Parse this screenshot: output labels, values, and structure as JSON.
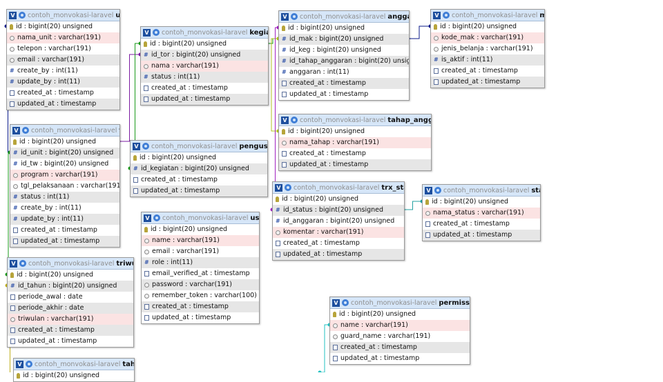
{
  "db_name": "contoh_monvokasi-laravel",
  "toggle_label": "V",
  "tables": [
    {
      "id": "unit",
      "name": "unit",
      "columns": [
        {
          "text": "id : bigint(20) unsigned",
          "icon": "key",
          "style": "pk"
        },
        {
          "text": "nama_unit : varchar(191)",
          "icon": "txt",
          "style": "hl"
        },
        {
          "text": "telepon : varchar(191)",
          "icon": "txt",
          "style": ""
        },
        {
          "text": "email : varchar(191)",
          "icon": "txt",
          "style": "zebra"
        },
        {
          "text": "create_by : int(11)",
          "icon": "hash",
          "style": ""
        },
        {
          "text": "update_by : int(11)",
          "icon": "hash",
          "style": "zebra"
        },
        {
          "text": "created_at : timestamp",
          "icon": "cal",
          "style": ""
        },
        {
          "text": "updated_at : timestamp",
          "icon": "cal",
          "style": "zebra"
        }
      ]
    },
    {
      "id": "kegiatan",
      "name": "kegiatan",
      "columns": [
        {
          "text": "id : bigint(20) unsigned",
          "icon": "key",
          "style": "pk"
        },
        {
          "text": "id_tor : bigint(20) unsigned",
          "icon": "hash",
          "style": "zebra"
        },
        {
          "text": "nama : varchar(191)",
          "icon": "txt",
          "style": "hl"
        },
        {
          "text": "status : int(11)",
          "icon": "hash",
          "style": "zebra"
        },
        {
          "text": "created_at : timestamp",
          "icon": "cal",
          "style": ""
        },
        {
          "text": "updated_at : timestamp",
          "icon": "cal",
          "style": "zebra"
        }
      ]
    },
    {
      "id": "anggaran",
      "name": "anggaran",
      "columns": [
        {
          "text": "id : bigint(20) unsigned",
          "icon": "key",
          "style": "pk"
        },
        {
          "text": "id_mak : bigint(20) unsigned",
          "icon": "hash",
          "style": "zebra"
        },
        {
          "text": "id_keg : bigint(20) unsigned",
          "icon": "hash",
          "style": ""
        },
        {
          "text": "id_tahap_anggaran : bigint(20) unsigned",
          "icon": "hash",
          "style": "zebra"
        },
        {
          "text": "anggaran : int(11)",
          "icon": "hash",
          "style": ""
        },
        {
          "text": "created_at : timestamp",
          "icon": "cal",
          "style": "zebra"
        },
        {
          "text": "updated_at : timestamp",
          "icon": "cal",
          "style": ""
        }
      ]
    },
    {
      "id": "mak",
      "name": "mak",
      "columns": [
        {
          "text": "id : bigint(20) unsigned",
          "icon": "key",
          "style": "pk"
        },
        {
          "text": "kode_mak : varchar(191)",
          "icon": "txt",
          "style": "hl"
        },
        {
          "text": "jenis_belanja : varchar(191)",
          "icon": "txt",
          "style": ""
        },
        {
          "text": "is_aktif : int(11)",
          "icon": "hash",
          "style": "zebra"
        },
        {
          "text": "created_at : timestamp",
          "icon": "cal",
          "style": ""
        },
        {
          "text": "updated_at : timestamp",
          "icon": "cal",
          "style": "zebra"
        }
      ]
    },
    {
      "id": "tor",
      "name": "tor",
      "columns": [
        {
          "text": "id : bigint(20) unsigned",
          "icon": "key",
          "style": "pk"
        },
        {
          "text": "id_unit : bigint(20) unsigned",
          "icon": "hash",
          "style": "zebra"
        },
        {
          "text": "id_tw : bigint(20) unsigned",
          "icon": "hash",
          "style": ""
        },
        {
          "text": "program : varchar(191)",
          "icon": "txt",
          "style": "hl"
        },
        {
          "text": "tgl_pelaksanaan : varchar(191)",
          "icon": "txt",
          "style": ""
        },
        {
          "text": "status : int(11)",
          "icon": "hash",
          "style": "zebra"
        },
        {
          "text": "create_by : int(11)",
          "icon": "hash",
          "style": ""
        },
        {
          "text": "update_by : int(11)",
          "icon": "hash",
          "style": "zebra"
        },
        {
          "text": "created_at : timestamp",
          "icon": "cal",
          "style": ""
        },
        {
          "text": "updated_at : timestamp",
          "icon": "cal",
          "style": "zebra"
        }
      ]
    },
    {
      "id": "pengusulan",
      "name": "pengusulan",
      "columns": [
        {
          "text": "id : bigint(20) unsigned",
          "icon": "key",
          "style": "pk"
        },
        {
          "text": "id_kegiatan : bigint(20) unsigned",
          "icon": "hash",
          "style": "zebra"
        },
        {
          "text": "created_at : timestamp",
          "icon": "cal",
          "style": ""
        },
        {
          "text": "updated_at : timestamp",
          "icon": "cal",
          "style": "zebra"
        }
      ]
    },
    {
      "id": "tahap_anggaran",
      "name": "tahap_anggaran",
      "columns": [
        {
          "text": "id : bigint(20) unsigned",
          "icon": "key",
          "style": "pk"
        },
        {
          "text": "nama_tahap : varchar(191)",
          "icon": "txt",
          "style": "hl"
        },
        {
          "text": "created_at : timestamp",
          "icon": "cal",
          "style": ""
        },
        {
          "text": "updated_at : timestamp",
          "icon": "cal",
          "style": "zebra"
        }
      ]
    },
    {
      "id": "trx_status",
      "name": "trx_status",
      "columns": [
        {
          "text": "id : bigint(20) unsigned",
          "icon": "key",
          "style": "pk"
        },
        {
          "text": "id_status : bigint(20) unsigned",
          "icon": "hash",
          "style": "zebra"
        },
        {
          "text": "id_anggaran : bigint(20) unsigned",
          "icon": "hash",
          "style": ""
        },
        {
          "text": "komentar : varchar(191)",
          "icon": "txt",
          "style": "hl"
        },
        {
          "text": "created_at : timestamp",
          "icon": "cal",
          "style": ""
        },
        {
          "text": "updated_at : timestamp",
          "icon": "cal",
          "style": "zebra"
        }
      ]
    },
    {
      "id": "status",
      "name": "status",
      "columns": [
        {
          "text": "id : bigint(20) unsigned",
          "icon": "key",
          "style": "pk"
        },
        {
          "text": "nama_status : varchar(191)",
          "icon": "txt",
          "style": "hl"
        },
        {
          "text": "created_at : timestamp",
          "icon": "cal",
          "style": ""
        },
        {
          "text": "updated_at : timestamp",
          "icon": "cal",
          "style": "zebra"
        }
      ]
    },
    {
      "id": "users",
      "name": "users",
      "columns": [
        {
          "text": "id : bigint(20) unsigned",
          "icon": "key",
          "style": "pk"
        },
        {
          "text": "name : varchar(191)",
          "icon": "txt",
          "style": "hl"
        },
        {
          "text": "email : varchar(191)",
          "icon": "txt",
          "style": ""
        },
        {
          "text": "role : int(11)",
          "icon": "hash",
          "style": "zebra"
        },
        {
          "text": "email_verified_at : timestamp",
          "icon": "cal",
          "style": ""
        },
        {
          "text": "password : varchar(191)",
          "icon": "txt",
          "style": "zebra"
        },
        {
          "text": "remember_token : varchar(100)",
          "icon": "txt",
          "style": ""
        },
        {
          "text": "created_at : timestamp",
          "icon": "cal",
          "style": "zebra"
        },
        {
          "text": "updated_at : timestamp",
          "icon": "cal",
          "style": ""
        }
      ]
    },
    {
      "id": "triwulan",
      "name": "triwulan",
      "columns": [
        {
          "text": "id : bigint(20) unsigned",
          "icon": "key",
          "style": "pk"
        },
        {
          "text": "id_tahun : bigint(20) unsigned",
          "icon": "hash",
          "style": "zebra"
        },
        {
          "text": "periode_awal : date",
          "icon": "cal",
          "style": ""
        },
        {
          "text": "periode_akhir : date",
          "icon": "cal",
          "style": "zebra"
        },
        {
          "text": "triwulan : varchar(191)",
          "icon": "txt",
          "style": "hl"
        },
        {
          "text": "created_at : timestamp",
          "icon": "cal",
          "style": "zebra"
        },
        {
          "text": "updated_at : timestamp",
          "icon": "cal",
          "style": ""
        }
      ]
    },
    {
      "id": "permissions",
      "name": "permissions",
      "columns": [
        {
          "text": "id : bigint(20) unsigned",
          "icon": "key",
          "style": "pk"
        },
        {
          "text": "name : varchar(191)",
          "icon": "txt",
          "style": "hl"
        },
        {
          "text": "guard_name : varchar(191)",
          "icon": "txt",
          "style": ""
        },
        {
          "text": "created_at : timestamp",
          "icon": "cal",
          "style": "zebra"
        },
        {
          "text": "updated_at : timestamp",
          "icon": "cal",
          "style": ""
        }
      ]
    },
    {
      "id": "tahun",
      "name": "tahun",
      "columns": [
        {
          "text": "id : bigint(20) unsigned",
          "icon": "key",
          "style": "pk"
        }
      ]
    }
  ],
  "relations": [
    {
      "from": "tor",
      "to": "unit",
      "color": "#0a1a8a"
    },
    {
      "from": "kegiatan",
      "to": "tor",
      "color": "#7a1aa0"
    },
    {
      "from": "pengusulan",
      "to": "kegiatan",
      "color": "#1a9a1a"
    },
    {
      "from": "anggaran",
      "to": "kegiatan",
      "color": "#1a9a1a"
    },
    {
      "from": "anggaran",
      "to": "mak",
      "color": "#0a1a8a"
    },
    {
      "from": "anggaran",
      "to": "tahap_anggaran",
      "color": "#b0c020"
    },
    {
      "from": "trx_status",
      "to": "anggaran",
      "color": "#a020c0"
    },
    {
      "from": "trx_status",
      "to": "status",
      "color": "#20a0a0"
    },
    {
      "from": "tor",
      "to": "triwulan",
      "color": "#1a9a1a"
    },
    {
      "from": "triwulan",
      "to": "tahun",
      "color": "#c0b020"
    },
    {
      "from": "permissions",
      "to": "offscreen",
      "color": "#20c0c0"
    }
  ]
}
